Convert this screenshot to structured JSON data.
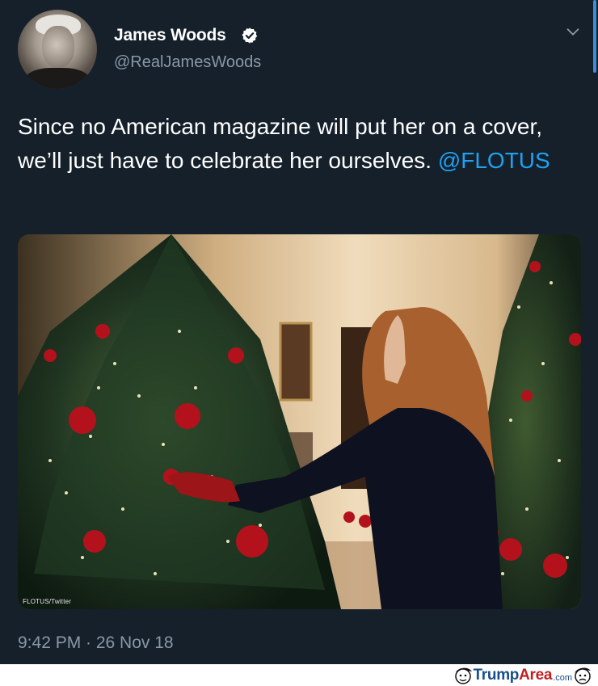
{
  "tweet": {
    "display_name": "James Woods",
    "handle": "@RealJamesWoods",
    "text_prefix": "Since no American magazine will put her on a cover, we’ll just have to celebrate her ourselves. ",
    "mention": "@FLOTUS",
    "timestamp": "9:42 PM · 26 Nov 18",
    "media_watermark": "FLOTUS/Twitter",
    "icons": [
      "verified-badge-icon",
      "chevron-down-icon"
    ],
    "colors": {
      "background": "#15202b",
      "link": "#1da1f2",
      "secondary_text": "#8899a6"
    }
  },
  "footer": {
    "logo_part1": "Trump",
    "logo_part2": "Area",
    "logo_suffix": ".com"
  }
}
